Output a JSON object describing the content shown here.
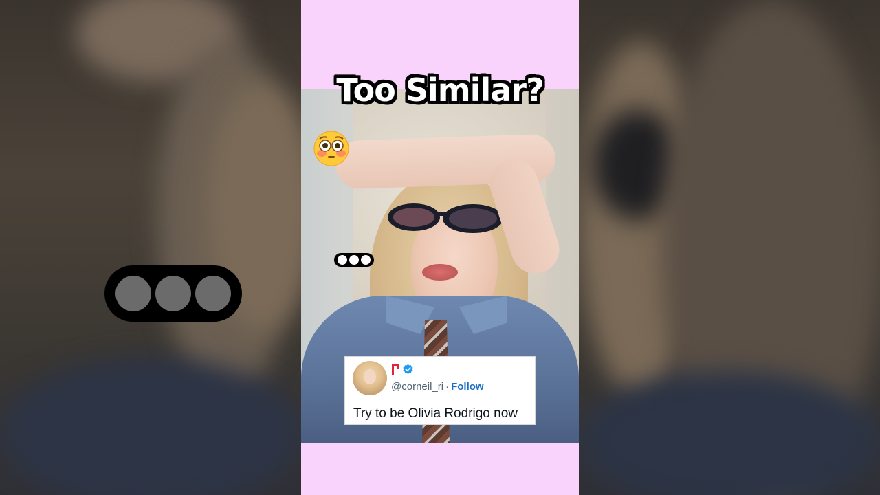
{
  "title": "Too Similar?",
  "emoji": "😳",
  "emoji_icon": "flushed-face-icon",
  "tweet": {
    "handle": "@corneil_ri",
    "separator": "·",
    "follow_label": "Follow",
    "text": "Try to be Olivia Rodrigo now",
    "verified_icon": "verified-badge-icon",
    "verified_color": "#1d9bf0"
  },
  "colors": {
    "panel_bg": "#f9d3fb",
    "follow_link": "#1b6fc6"
  }
}
